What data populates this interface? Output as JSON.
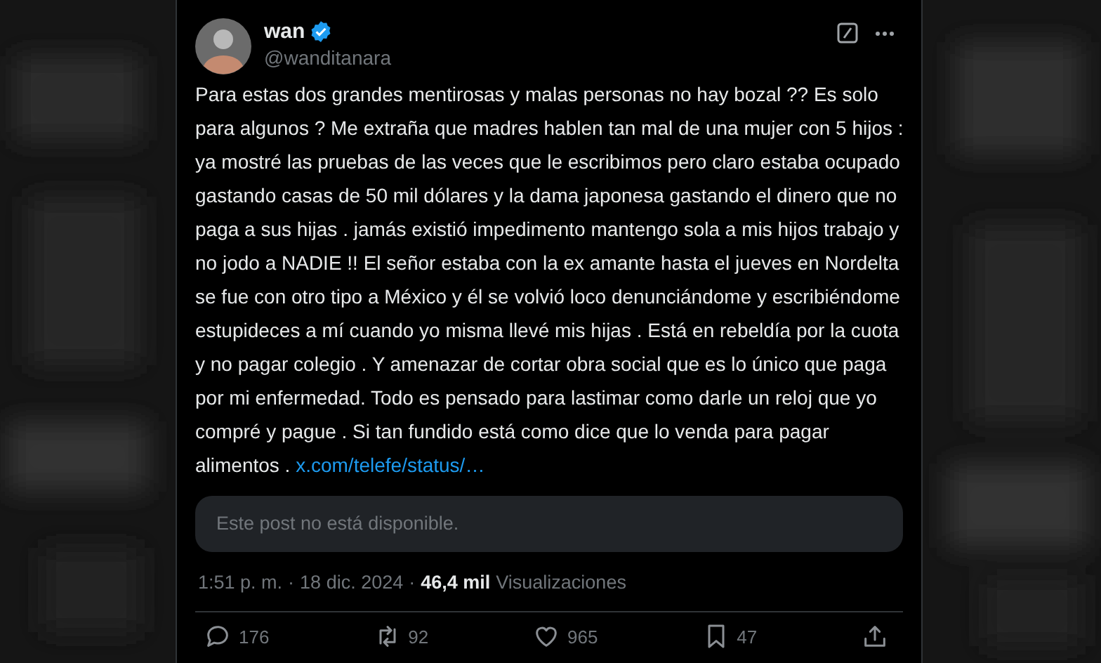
{
  "post": {
    "author": {
      "name": "wan",
      "verified": true,
      "handle": "@wanditanara"
    },
    "text": "Para estas dos grandes mentirosas y malas personas no hay bozal ?? Es solo para algunos ? Me extraña que madres hablen tan mal de una mujer con 5 hijos : ya mostré las pruebas de las veces que le escribimos pero claro estaba ocupado gastando casas de 50 mil dólares y la dama japonesa gastando el dinero que no paga a sus hijas .  jamás existió impedimento mantengo sola a mis hijos trabajo y no jodo a NADIE !! El señor estaba con la ex amante hasta el jueves en Nordelta se fue con otro tipo a México y él se volvió loco denunciándome y escribiéndome estupideces a mí cuando yo misma llevé mis hijas .  Está en rebeldía por la cuota y no pagar colegio . Y amenazar de cortar obra social que es lo único que paga por mi enfermedad. Todo es pensado para lastimar como darle un reloj que yo compré y pague . Si tan fundido está como dice que lo venda para pagar alimentos .",
    "link": "x.com/telefe/status/…",
    "quote_unavailable": "Este post no está disponible.",
    "time": "1:51 p. m.",
    "separator": "·",
    "date": "18 dic. 2024",
    "views_count": "46,4 mil",
    "views_label": "Visualizaciones",
    "actions": [
      {
        "kind": "reply",
        "count": "176"
      },
      {
        "kind": "repost",
        "count": "92"
      },
      {
        "kind": "like",
        "count": "965"
      },
      {
        "kind": "bookmark",
        "count": "47"
      },
      {
        "kind": "share"
      }
    ]
  }
}
